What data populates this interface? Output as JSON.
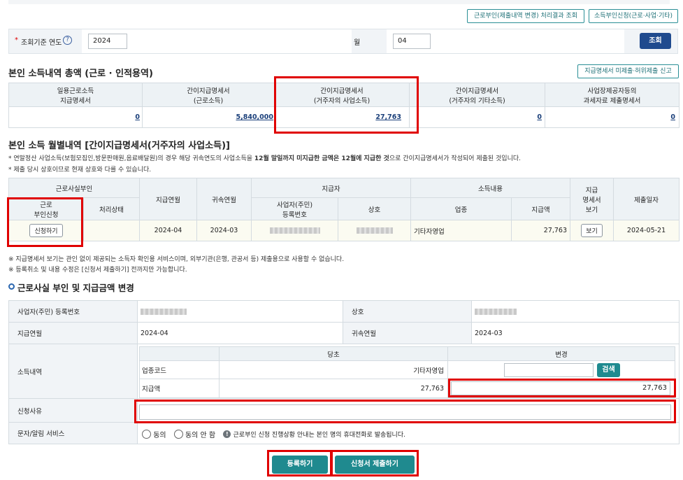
{
  "top_buttons": {
    "result_inquiry": "근로부인(제출내역 변경) 처리결과 조회",
    "income_denial": "소득부인신청(근로·사업·기타)"
  },
  "search": {
    "year_label": "조회기준 연도",
    "year_value": "2024",
    "month_label": "월",
    "month_value": "04",
    "submit_label": "조회"
  },
  "summary": {
    "title": "본인 소득내역 총액 (근로 · 인적용역)",
    "report_button": "지급명세서 미제출·허위제출 신고",
    "columns": [
      "일용근로소득\n지급명세서",
      "간이지급명세서\n(근로소득)",
      "간이지급명세서\n(거주자의 사업소득)",
      "간이지급명세서\n(거주자의 기타소득)",
      "사업장제공자등의\n과세자료 제출명세서"
    ],
    "values": [
      "0",
      "5,840,000",
      "27,763",
      "0",
      "0"
    ]
  },
  "monthly": {
    "title": "본인 소득 월별내역 [간이지급명세서(거주자의 사업소득)]",
    "note1_pre": "* 연말정산 사업소득(보험모집인,방문판매원,음료배달원)의 경우 해당 귀속연도의 사업소득을 ",
    "note1_bold": "12월 말일까지 미지급한 금액은 12월에 지급한 것",
    "note1_post": "으로  간이지급명세서가 작성되어 제출된 것입니다.",
    "note2": "* 제출 당시 상호이므로 현재 상호와 다를 수 있습니다.",
    "headers": {
      "denial": "근로사실부인",
      "denial_request": "근로\n부인신청",
      "status": "처리상태",
      "pay_month": "지급연월",
      "belong_month": "귀속연월",
      "payer": "지급자",
      "reg_no": "사업자(주민)\n등록번호",
      "company": "상호",
      "income": "소득내용",
      "industry": "업종",
      "amount": "지급액",
      "view": "지급\n명세서\n보기",
      "submit_date": "제출일자"
    },
    "row": {
      "apply_button": "신청하기",
      "status": "",
      "pay_month": "2024-04",
      "belong_month": "2024-03",
      "industry": "기타자영업",
      "amount": "27,763",
      "view_button": "보기",
      "submit_date": "2024-05-21"
    },
    "foot1": "※ 지급명세서 보기는 관인 없이 제공되는 소득자 확인용 서비스이며, 외부기관(은행, 관공서 등) 제출용으로 사용할 수 없습니다.",
    "foot2": "※ 등록취소 및 내용 수정은 [신청서 제출하기] 전까지만 가능합니다."
  },
  "change": {
    "title": "근로사실 부인 및 지급금액 변경",
    "reg_no_label": "사업자(주민) 등록번호",
    "company_label": "상호",
    "pay_month_label": "지급연월",
    "pay_month_value": "2024-04",
    "belong_month_label": "귀속연월",
    "belong_month_value": "2024-03",
    "income_label": "소득내역",
    "current_label": "당초",
    "changed_label": "변경",
    "industry_code_label": "업종코드",
    "industry_current": "기타자영업",
    "search_button": "검색",
    "amount_label": "지급액",
    "amount_current": "27,763",
    "amount_changed": "27,763",
    "reason_label": "신청사유",
    "reason_value": "",
    "sms_label": "문자/알림 서비스",
    "agree": "동의",
    "disagree": "동의 안 함",
    "sms_info": "근로부인 신청 진행상황 안내는 본인 명의 휴대전화로 발송됩니다."
  },
  "actions": {
    "register": "등록하기",
    "submit": "신청서 제출하기"
  },
  "colors": {
    "navy": "#1f4a8e",
    "teal": "#1f8a8f",
    "highlight_red": "#e00000",
    "link": "#1a3f7a"
  }
}
